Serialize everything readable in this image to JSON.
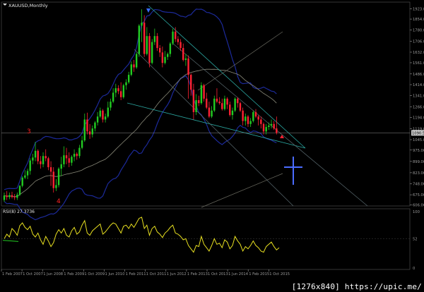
{
  "window": {
    "symbol_title": "XAUUSD,Monthly",
    "rsi_title": "RSI(8) 27.3736"
  },
  "watermark": "[1276x840] https://upic.me/",
  "colors": {
    "background": "#000000",
    "bull": "#22cc22",
    "bear": "#ff2233",
    "axis": "#9a9a9a",
    "trendline": "#2aa6a0",
    "bollinger": "#1c2a9a",
    "ma": "#8a8a7a",
    "rsi_line": "#e8e020",
    "rsi_level": "#22cc22",
    "crosshair": "#4a6cff",
    "arrow": "#3a6cff",
    "wave_label": "#ff2222",
    "price_marker_bg": "#c8c8c8"
  },
  "price_axis": {
    "labels": [
      "1923.00",
      "1854.00",
      "1780.00",
      "1706.00",
      "1632.00",
      "1561.00",
      "1486.00",
      "1414.00",
      "1341.00",
      "1266.00",
      "1194.00",
      "1119.00",
      "1045.00",
      "975.00",
      "899.00",
      "823.00",
      "748.00",
      "675.00",
      "606.00"
    ],
    "current_price": "1090.50"
  },
  "rsi_axis": {
    "labels": [
      "100",
      "52",
      "0"
    ]
  },
  "time_axis": {
    "labels": [
      "1 Feb 2007",
      "1 Oct 2007",
      "1 Jun 2008",
      "1 Feb 2009",
      "1 Oct 2009",
      "1 Jun 2010",
      "1 Feb 2011",
      "1 Oct 2011",
      "1 Jun 2012",
      "1 Feb 2013",
      "1 Oct 2013",
      "1 Jun 2014",
      "1 Feb 2015",
      "1 Oct 2015"
    ]
  },
  "wave_labels": [
    "3",
    "4"
  ],
  "chart_data": {
    "type": "candlestick",
    "title": "XAUUSD,Monthly",
    "ylim": [
      600,
      1930
    ],
    "candles": [
      {
        "o": 640,
        "h": 690,
        "l": 628,
        "c": 670
      },
      {
        "o": 670,
        "h": 700,
        "l": 640,
        "c": 660
      },
      {
        "o": 660,
        "h": 690,
        "l": 645,
        "c": 672
      },
      {
        "o": 672,
        "h": 695,
        "l": 650,
        "c": 660
      },
      {
        "o": 660,
        "h": 680,
        "l": 640,
        "c": 655
      },
      {
        "o": 655,
        "h": 690,
        "l": 640,
        "c": 675
      },
      {
        "o": 675,
        "h": 740,
        "l": 668,
        "c": 735
      },
      {
        "o": 735,
        "h": 800,
        "l": 725,
        "c": 790
      },
      {
        "o": 790,
        "h": 840,
        "l": 780,
        "c": 805
      },
      {
        "o": 805,
        "h": 850,
        "l": 780,
        "c": 835
      },
      {
        "o": 835,
        "h": 920,
        "l": 810,
        "c": 905
      },
      {
        "o": 905,
        "h": 950,
        "l": 880,
        "c": 925
      },
      {
        "o": 925,
        "h": 1030,
        "l": 900,
        "c": 970
      },
      {
        "o": 970,
        "h": 980,
        "l": 880,
        "c": 900
      },
      {
        "o": 900,
        "h": 935,
        "l": 850,
        "c": 880
      },
      {
        "o": 880,
        "h": 960,
        "l": 860,
        "c": 935
      },
      {
        "o": 935,
        "h": 980,
        "l": 900,
        "c": 920
      },
      {
        "o": 920,
        "h": 930,
        "l": 840,
        "c": 860
      },
      {
        "o": 860,
        "h": 900,
        "l": 735,
        "c": 830
      },
      {
        "o": 830,
        "h": 860,
        "l": 690,
        "c": 720
      },
      {
        "o": 720,
        "h": 780,
        "l": 700,
        "c": 740
      },
      {
        "o": 740,
        "h": 860,
        "l": 725,
        "c": 850
      },
      {
        "o": 850,
        "h": 930,
        "l": 800,
        "c": 880
      },
      {
        "o": 880,
        "h": 1000,
        "l": 860,
        "c": 940
      },
      {
        "o": 940,
        "h": 990,
        "l": 880,
        "c": 920
      },
      {
        "o": 920,
        "h": 960,
        "l": 860,
        "c": 890
      },
      {
        "o": 890,
        "h": 940,
        "l": 870,
        "c": 930
      },
      {
        "o": 930,
        "h": 980,
        "l": 900,
        "c": 950
      },
      {
        "o": 950,
        "h": 960,
        "l": 910,
        "c": 935
      },
      {
        "o": 935,
        "h": 1010,
        "l": 920,
        "c": 990
      },
      {
        "o": 990,
        "h": 1070,
        "l": 980,
        "c": 1040
      },
      {
        "o": 1040,
        "h": 1220,
        "l": 1030,
        "c": 1180
      },
      {
        "o": 1180,
        "h": 1226,
        "l": 1080,
        "c": 1100
      },
      {
        "o": 1100,
        "h": 1150,
        "l": 1050,
        "c": 1080
      },
      {
        "o": 1080,
        "h": 1140,
        "l": 1060,
        "c": 1120
      },
      {
        "o": 1120,
        "h": 1170,
        "l": 1100,
        "c": 1160
      },
      {
        "o": 1160,
        "h": 1230,
        "l": 1140,
        "c": 1200
      },
      {
        "o": 1200,
        "h": 1260,
        "l": 1190,
        "c": 1240
      },
      {
        "o": 1240,
        "h": 1250,
        "l": 1160,
        "c": 1180
      },
      {
        "o": 1180,
        "h": 1220,
        "l": 1160,
        "c": 1200
      },
      {
        "o": 1200,
        "h": 1300,
        "l": 1190,
        "c": 1260
      },
      {
        "o": 1260,
        "h": 1320,
        "l": 1240,
        "c": 1300
      },
      {
        "o": 1300,
        "h": 1390,
        "l": 1290,
        "c": 1360
      },
      {
        "o": 1360,
        "h": 1420,
        "l": 1330,
        "c": 1390
      },
      {
        "o": 1390,
        "h": 1410,
        "l": 1350,
        "c": 1370
      },
      {
        "o": 1370,
        "h": 1430,
        "l": 1310,
        "c": 1330
      },
      {
        "o": 1330,
        "h": 1420,
        "l": 1320,
        "c": 1410
      },
      {
        "o": 1410,
        "h": 1450,
        "l": 1380,
        "c": 1430
      },
      {
        "o": 1430,
        "h": 1500,
        "l": 1420,
        "c": 1480
      },
      {
        "o": 1480,
        "h": 1570,
        "l": 1470,
        "c": 1550
      },
      {
        "o": 1550,
        "h": 1580,
        "l": 1500,
        "c": 1530
      },
      {
        "o": 1530,
        "h": 1630,
        "l": 1520,
        "c": 1620
      },
      {
        "o": 1620,
        "h": 1820,
        "l": 1600,
        "c": 1810
      },
      {
        "o": 1810,
        "h": 1920,
        "l": 1700,
        "c": 1830
      },
      {
        "o": 1830,
        "h": 1880,
        "l": 1600,
        "c": 1620
      },
      {
        "o": 1620,
        "h": 1800,
        "l": 1610,
        "c": 1740
      },
      {
        "o": 1740,
        "h": 1760,
        "l": 1530,
        "c": 1560
      },
      {
        "o": 1560,
        "h": 1720,
        "l": 1550,
        "c": 1700
      },
      {
        "o": 1700,
        "h": 1790,
        "l": 1680,
        "c": 1740
      },
      {
        "o": 1740,
        "h": 1760,
        "l": 1640,
        "c": 1660
      },
      {
        "o": 1660,
        "h": 1680,
        "l": 1600,
        "c": 1630
      },
      {
        "o": 1630,
        "h": 1670,
        "l": 1530,
        "c": 1560
      },
      {
        "o": 1560,
        "h": 1640,
        "l": 1550,
        "c": 1600
      },
      {
        "o": 1600,
        "h": 1630,
        "l": 1580,
        "c": 1620
      },
      {
        "o": 1620,
        "h": 1700,
        "l": 1600,
        "c": 1690
      },
      {
        "o": 1690,
        "h": 1790,
        "l": 1680,
        "c": 1770
      },
      {
        "o": 1770,
        "h": 1800,
        "l": 1700,
        "c": 1720
      },
      {
        "o": 1720,
        "h": 1740,
        "l": 1680,
        "c": 1700
      },
      {
        "o": 1700,
        "h": 1720,
        "l": 1640,
        "c": 1660
      },
      {
        "o": 1660,
        "h": 1690,
        "l": 1570,
        "c": 1580
      },
      {
        "o": 1580,
        "h": 1620,
        "l": 1540,
        "c": 1590
      },
      {
        "o": 1590,
        "h": 1610,
        "l": 1320,
        "c": 1480
      },
      {
        "o": 1480,
        "h": 1490,
        "l": 1340,
        "c": 1380
      },
      {
        "o": 1380,
        "h": 1420,
        "l": 1180,
        "c": 1230
      },
      {
        "o": 1230,
        "h": 1350,
        "l": 1210,
        "c": 1310
      },
      {
        "o": 1310,
        "h": 1340,
        "l": 1270,
        "c": 1290
      },
      {
        "o": 1290,
        "h": 1430,
        "l": 1280,
        "c": 1410
      },
      {
        "o": 1410,
        "h": 1420,
        "l": 1300,
        "c": 1320
      },
      {
        "o": 1320,
        "h": 1360,
        "l": 1250,
        "c": 1260
      },
      {
        "o": 1260,
        "h": 1300,
        "l": 1190,
        "c": 1200
      },
      {
        "o": 1200,
        "h": 1270,
        "l": 1190,
        "c": 1240
      },
      {
        "o": 1240,
        "h": 1340,
        "l": 1230,
        "c": 1320
      },
      {
        "o": 1320,
        "h": 1390,
        "l": 1290,
        "c": 1300
      },
      {
        "o": 1300,
        "h": 1330,
        "l": 1280,
        "c": 1290
      },
      {
        "o": 1290,
        "h": 1320,
        "l": 1240,
        "c": 1250
      },
      {
        "o": 1250,
        "h": 1340,
        "l": 1240,
        "c": 1320
      },
      {
        "o": 1320,
        "h": 1330,
        "l": 1250,
        "c": 1280
      },
      {
        "o": 1280,
        "h": 1300,
        "l": 1200,
        "c": 1210
      },
      {
        "o": 1210,
        "h": 1260,
        "l": 1180,
        "c": 1240
      },
      {
        "o": 1240,
        "h": 1330,
        "l": 1230,
        "c": 1320
      },
      {
        "o": 1320,
        "h": 1330,
        "l": 1260,
        "c": 1290
      },
      {
        "o": 1290,
        "h": 1300,
        "l": 1230,
        "c": 1240
      },
      {
        "o": 1240,
        "h": 1260,
        "l": 1140,
        "c": 1170
      },
      {
        "o": 1170,
        "h": 1220,
        "l": 1140,
        "c": 1200
      },
      {
        "o": 1200,
        "h": 1210,
        "l": 1130,
        "c": 1150
      },
      {
        "o": 1150,
        "h": 1190,
        "l": 1130,
        "c": 1170
      },
      {
        "o": 1170,
        "h": 1240,
        "l": 1160,
        "c": 1230
      },
      {
        "o": 1230,
        "h": 1250,
        "l": 1190,
        "c": 1200
      },
      {
        "o": 1200,
        "h": 1210,
        "l": 1140,
        "c": 1180
      },
      {
        "o": 1180,
        "h": 1200,
        "l": 1120,
        "c": 1150
      },
      {
        "o": 1150,
        "h": 1160,
        "l": 1080,
        "c": 1100
      },
      {
        "o": 1100,
        "h": 1150,
        "l": 1080,
        "c": 1130
      },
      {
        "o": 1130,
        "h": 1160,
        "l": 1110,
        "c": 1140
      },
      {
        "o": 1140,
        "h": 1180,
        "l": 1120,
        "c": 1150
      },
      {
        "o": 1150,
        "h": 1170,
        "l": 1110,
        "c": 1120
      },
      {
        "o": 1120,
        "h": 1200,
        "l": 1080,
        "c": 1090
      }
    ],
    "rsi": [
      52,
      60,
      55,
      70,
      65,
      58,
      75,
      80,
      72,
      68,
      74,
      60,
      55,
      62,
      50,
      42,
      56,
      48,
      38,
      45,
      60,
      68,
      62,
      70,
      58,
      55,
      66,
      72,
      60,
      64,
      76,
      84,
      62,
      58,
      66,
      70,
      74,
      78,
      60,
      64,
      70,
      76,
      80,
      78,
      70,
      62,
      74,
      76,
      70,
      78,
      72,
      80,
      88,
      90,
      70,
      76,
      58,
      70,
      74,
      64,
      60,
      54,
      62,
      66,
      72,
      76,
      62,
      60,
      56,
      50,
      52,
      40,
      34,
      28,
      40,
      38,
      56,
      42,
      36,
      30,
      40,
      52,
      42,
      44,
      36,
      50,
      46,
      34,
      40,
      56,
      48,
      42,
      30,
      38,
      34,
      40,
      48,
      40,
      36,
      30,
      28,
      38,
      42,
      46,
      38,
      32,
      36
    ],
    "rsi_ylim": [
      0,
      100
    ]
  }
}
